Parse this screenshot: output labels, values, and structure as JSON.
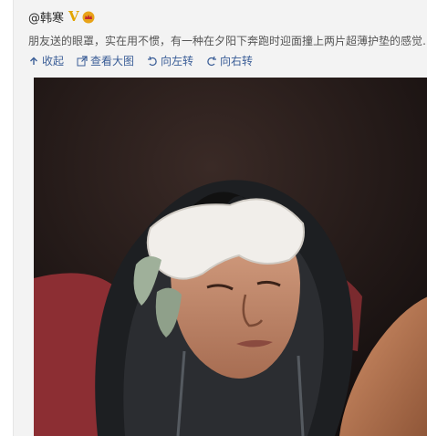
{
  "post": {
    "username": "@韩寒",
    "text": "朋友送的眼罩，实在用不惯，有一种在夕阳下奔跑时迎面撞上两片超薄护垫的感觉…"
  },
  "toolbar": {
    "collapse_label": "收起",
    "view_large_label": "查看大图",
    "rotate_left_label": "向左转",
    "rotate_right_label": "向右转"
  },
  "colors": {
    "link": "#3b5e97",
    "verified_badge": "#e2a500",
    "background": "#f3f3f3"
  },
  "icons": [
    "v-badge",
    "crown-icon",
    "collapse-icon",
    "view-large-icon",
    "rotate-left-icon",
    "rotate-right-icon"
  ]
}
